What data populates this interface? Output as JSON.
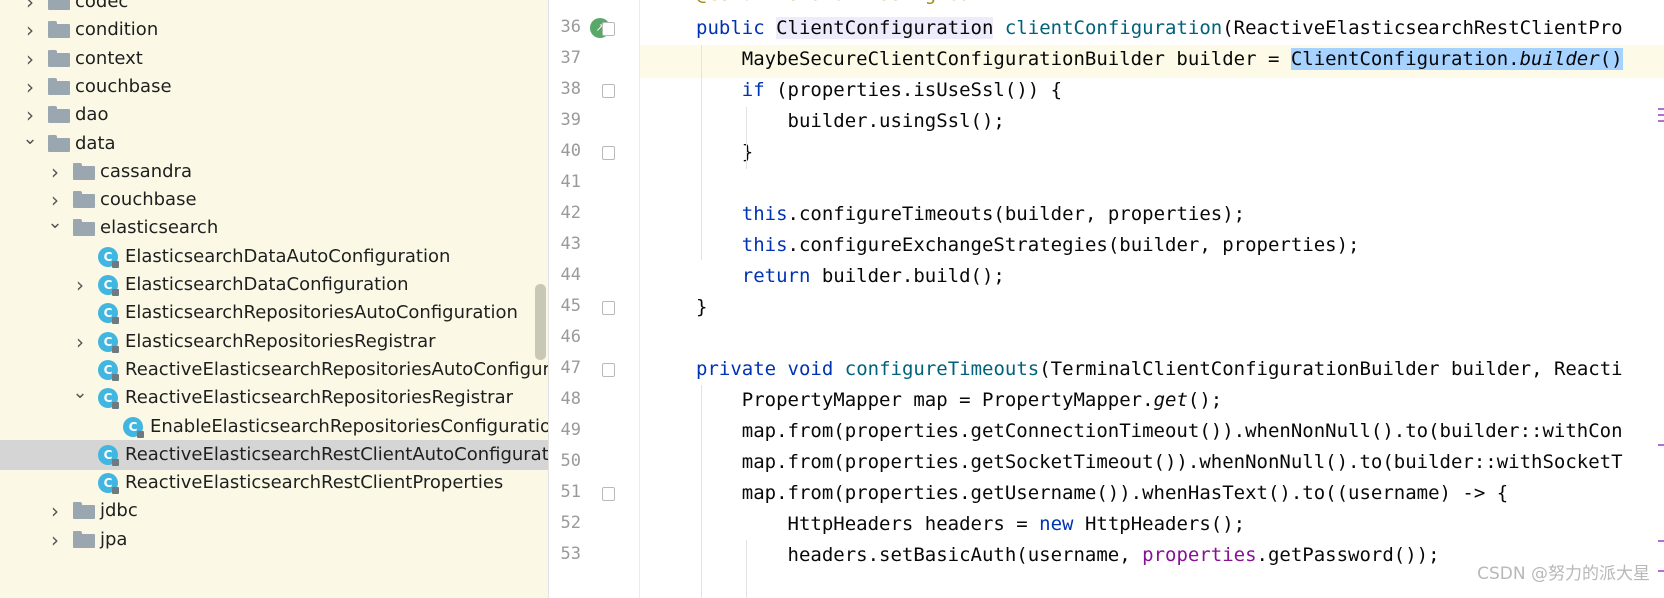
{
  "tree": {
    "items": [
      {
        "label": "codec",
        "kind": "folder",
        "depth": 0,
        "expanded": false
      },
      {
        "label": "condition",
        "kind": "folder",
        "depth": 0,
        "expanded": false
      },
      {
        "label": "context",
        "kind": "folder",
        "depth": 0,
        "expanded": false
      },
      {
        "label": "couchbase",
        "kind": "folder",
        "depth": 0,
        "expanded": false
      },
      {
        "label": "dao",
        "kind": "folder",
        "depth": 0,
        "expanded": false
      },
      {
        "label": "data",
        "kind": "folder",
        "depth": 0,
        "expanded": true
      },
      {
        "label": "cassandra",
        "kind": "folder",
        "depth": 1,
        "expanded": false
      },
      {
        "label": "couchbase",
        "kind": "folder",
        "depth": 1,
        "expanded": false
      },
      {
        "label": "elasticsearch",
        "kind": "folder",
        "depth": 1,
        "expanded": true
      },
      {
        "label": "ElasticsearchDataAutoConfiguration",
        "kind": "class",
        "depth": 2,
        "chevron": "none"
      },
      {
        "label": "ElasticsearchDataConfiguration",
        "kind": "class",
        "depth": 2,
        "chevron": "collapsed"
      },
      {
        "label": "ElasticsearchRepositoriesAutoConfiguration",
        "kind": "class",
        "depth": 2,
        "chevron": "none"
      },
      {
        "label": "ElasticsearchRepositoriesRegistrar",
        "kind": "class",
        "depth": 2,
        "chevron": "collapsed"
      },
      {
        "label": "ReactiveElasticsearchRepositoriesAutoConfigurati",
        "kind": "class",
        "depth": 2,
        "chevron": "none"
      },
      {
        "label": "ReactiveElasticsearchRepositoriesRegistrar",
        "kind": "class",
        "depth": 2,
        "chevron": "expanded"
      },
      {
        "label": "EnableElasticsearchRepositoriesConfiguration",
        "kind": "class",
        "depth": 3,
        "chevron": "none"
      },
      {
        "label": "ReactiveElasticsearchRestClientAutoConfiguratio",
        "kind": "class",
        "depth": 2,
        "chevron": "none",
        "selected": true
      },
      {
        "label": "ReactiveElasticsearchRestClientProperties",
        "kind": "class",
        "depth": 2,
        "chevron": "none"
      },
      {
        "label": "jdbc",
        "kind": "folder",
        "depth": 1,
        "expanded": false
      },
      {
        "label": "jpa",
        "kind": "folder",
        "depth": 1,
        "expanded": false
      }
    ]
  },
  "editor": {
    "top_partial_line": "@ConditionalOnMissingBean",
    "lines": [
      {
        "number": "36",
        "text": "public ClientConfiguration clientConfiguration(ReactiveElasticsearchRestClientPro"
      },
      {
        "number": "37",
        "text": "    MaybeSecureClientConfigurationBuilder builder = ClientConfiguration.builder()"
      },
      {
        "number": "38",
        "text": "    if (properties.isUseSsl()) {"
      },
      {
        "number": "39",
        "text": "        builder.usingSsl();"
      },
      {
        "number": "40",
        "text": "    }"
      },
      {
        "number": "41",
        "text": ""
      },
      {
        "number": "42",
        "text": "    this.configureTimeouts(builder, properties);"
      },
      {
        "number": "43",
        "text": "    this.configureExchangeStrategies(builder, properties);"
      },
      {
        "number": "44",
        "text": "    return builder.build();"
      },
      {
        "number": "45",
        "text": "}"
      },
      {
        "number": "46",
        "text": ""
      },
      {
        "number": "47",
        "text": "private void configureTimeouts(TerminalClientConfigurationBuilder builder, Reacti"
      },
      {
        "number": "48",
        "text": "    PropertyMapper map = PropertyMapper.get();"
      },
      {
        "number": "49",
        "text": "    map.from(properties.getConnectionTimeout()).whenNonNull().to(builder::withCon"
      },
      {
        "number": "50",
        "text": "    map.from(properties.getSocketTimeout()).whenNonNull().to(builder::withSocketT"
      },
      {
        "number": "51",
        "text": "    map.from(properties.getUsername()).whenHasText().to((username) -> {"
      },
      {
        "number": "52",
        "text": "        HttpHeaders headers = new HttpHeaders();"
      },
      {
        "number": "53",
        "text": "        headers.setBasicAuth(username, properties.getPassword());"
      }
    ]
  },
  "watermark": "CSDN @努力的派大星",
  "colors": {
    "tree_bg": "#fbf9e6",
    "selection_row": "#d5d5d5",
    "keyword": "#0033b3",
    "method": "#00627a",
    "field": "#871094",
    "text_selection": "#a6d2ff"
  }
}
